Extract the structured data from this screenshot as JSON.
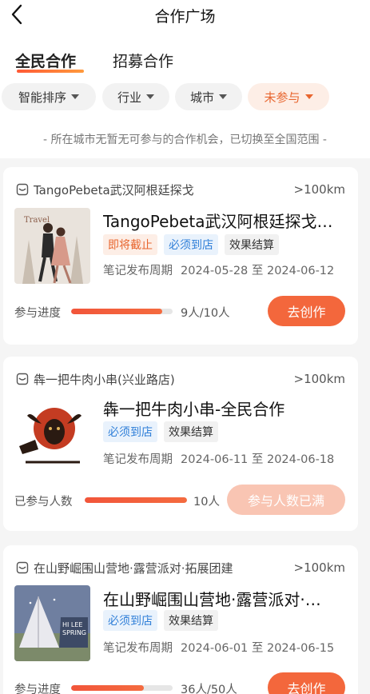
{
  "header": {
    "title": "合作广场"
  },
  "tabs": [
    {
      "label": "全民合作"
    },
    {
      "label": "招募合作"
    }
  ],
  "filters": [
    {
      "label": "智能排序"
    },
    {
      "label": "行业"
    },
    {
      "label": "城市"
    },
    {
      "label": "未参与"
    }
  ],
  "notice": "- 所在城市无暂无可参与的合作机会，已切换至全国范围 -",
  "cards": [
    {
      "store": "TangoPebeta武汉阿根廷探戈",
      "distance": ">100km",
      "title": "TangoPebeta武汉阿根廷探戈…",
      "tags": [
        "即将截止",
        "必须到店",
        "效果结算"
      ],
      "period_label": "笔记发布周期",
      "period": "2024-05-28 至 2024-06-12",
      "progress_label": "参与进度",
      "progress_fraction": 0.9,
      "progress_text": "9人/10人",
      "action": "去创作"
    },
    {
      "store": "犇一把牛肉小串(兴业路店)",
      "distance": ">100km",
      "title": "犇一把牛肉小串-全民合作",
      "tags": [
        "必须到店",
        "效果结算"
      ],
      "period_label": "笔记发布周期",
      "period": "2024-06-11 至 2024-06-18",
      "progress_label": "已参与人数",
      "progress_fraction": 1.0,
      "progress_text": "10人",
      "action": "参与人数已满"
    },
    {
      "store": "在山野崛围山营地·露营派对·拓展团建",
      "distance": ">100km",
      "title": "在山野崛围山营地·露营派对·…",
      "tags": [
        "必须到店",
        "效果结算"
      ],
      "period_label": "笔记发布周期",
      "period": "2024-06-01 至 2024-06-15",
      "progress_label": "参与进度",
      "progress_fraction": 0.72,
      "progress_text": "36人/50人",
      "action": "去创作"
    }
  ],
  "colors": {
    "accent": "#f3673c",
    "accent_light": "#f9c5b3",
    "tag_blue": "#2f7fd8"
  }
}
